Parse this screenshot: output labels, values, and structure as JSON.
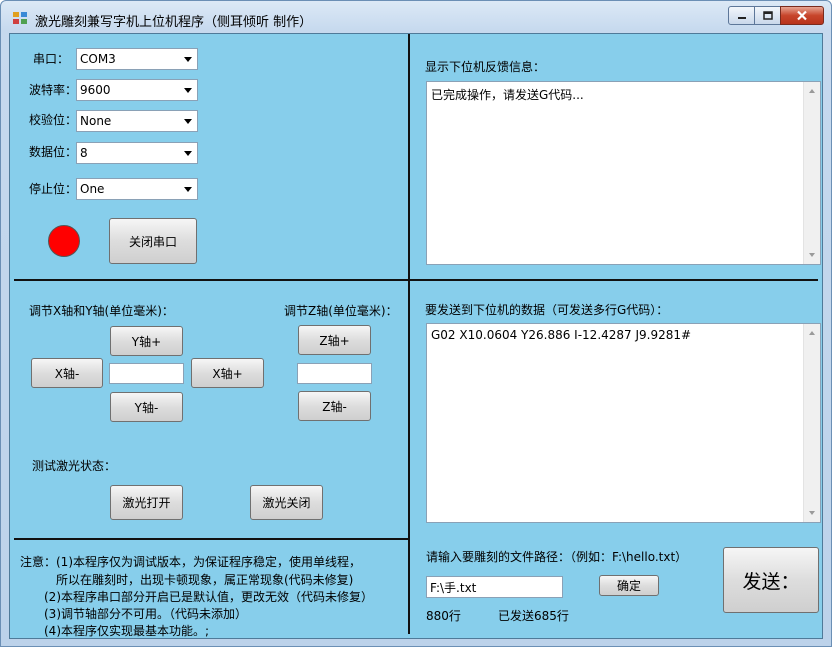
{
  "window": {
    "title": "激光雕刻兼写字机上位机程序（侧耳倾听 制作）",
    "close_color": "#c7452b"
  },
  "serial": {
    "port_label": "串口：",
    "port_value": "COM3",
    "baud_label": "波特率：",
    "baud_value": "9600",
    "parity_label": "校验位：",
    "parity_value": "None",
    "databits_label": "数据位：",
    "databits_value": "8",
    "stopbits_label": "停止位：",
    "stopbits_value": "One",
    "status_color": "#ff0000",
    "close_port_label": "关闭串口"
  },
  "feedback": {
    "label": "显示下位机反馈信息：",
    "text": "已完成操作，请发送G代码..."
  },
  "axis": {
    "xy_label": "调节X轴和Y轴(单位毫米)：",
    "z_label": "调节Z轴(单位毫米)：",
    "y_plus": "Y轴+",
    "y_minus": "Y轴-",
    "x_minus": "X轴-",
    "x_plus": "X轴+",
    "z_plus": "Z轴+",
    "z_minus": "Z轴-",
    "xy_step_value": "",
    "z_step_value": ""
  },
  "laser": {
    "label": "测试激光状态：",
    "on_label": "激光打开",
    "off_label": "激光关闭"
  },
  "send_data": {
    "label": "要发送到下位机的数据（可发送多行G代码）：",
    "text": "G02 X10.0604 Y26.886 I-12.4287 J9.9281#"
  },
  "file": {
    "label": "请输入要雕刻的文件路径：（例如：F:\\hello.txt）",
    "path_value": "F:\\手.txt",
    "confirm_label": "确定",
    "send_label": "发送：",
    "line_count": "880行",
    "sent_count": "已发送685行"
  },
  "notes": {
    "line1": "注意：(1)本程序仅为调试版本，为保证程序稳定，使用单线程，",
    "line2": "所以在雕刻时，出现卡顿现象，属正常现象(代码未修复)",
    "line3": "(2)本程序串口部分开启已是默认值，更改无效（代码未修复）",
    "line4": "(3)调节轴部分不可用。（代码未添加）",
    "line5": "(4)本程序仅实现最基本功能。;"
  }
}
